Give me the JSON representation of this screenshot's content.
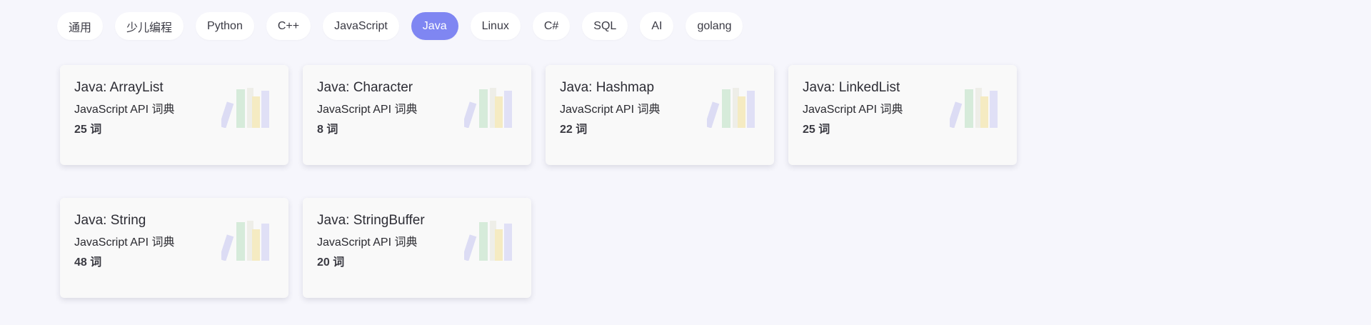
{
  "tabs": [
    {
      "label": "通用",
      "active": false
    },
    {
      "label": "少儿编程",
      "active": false
    },
    {
      "label": "Python",
      "active": false
    },
    {
      "label": "C++",
      "active": false
    },
    {
      "label": "JavaScript",
      "active": false
    },
    {
      "label": "Java",
      "active": true
    },
    {
      "label": "Linux",
      "active": false
    },
    {
      "label": "C#",
      "active": false
    },
    {
      "label": "SQL",
      "active": false
    },
    {
      "label": "AI",
      "active": false
    },
    {
      "label": "golang",
      "active": false
    }
  ],
  "cards": [
    {
      "title": "Java: ArrayList",
      "subtitle": "JavaScript API 词典",
      "count": "25 词"
    },
    {
      "title": "Java: Character",
      "subtitle": "JavaScript API 词典",
      "count": "8 词"
    },
    {
      "title": "Java: Hashmap",
      "subtitle": "JavaScript API 词典",
      "count": "22 词"
    },
    {
      "title": "Java: LinkedList",
      "subtitle": "JavaScript API 词典",
      "count": "25 词"
    },
    {
      "title": "Java: String",
      "subtitle": "JavaScript API 词典",
      "count": "48 词"
    },
    {
      "title": "Java: StringBuffer",
      "subtitle": "JavaScript API 词典",
      "count": "20 词"
    }
  ],
  "icon": "books-icon",
  "colors": {
    "accent": "#7f86f2",
    "background": "#f6f6fc",
    "card": "#f9f9f9"
  }
}
